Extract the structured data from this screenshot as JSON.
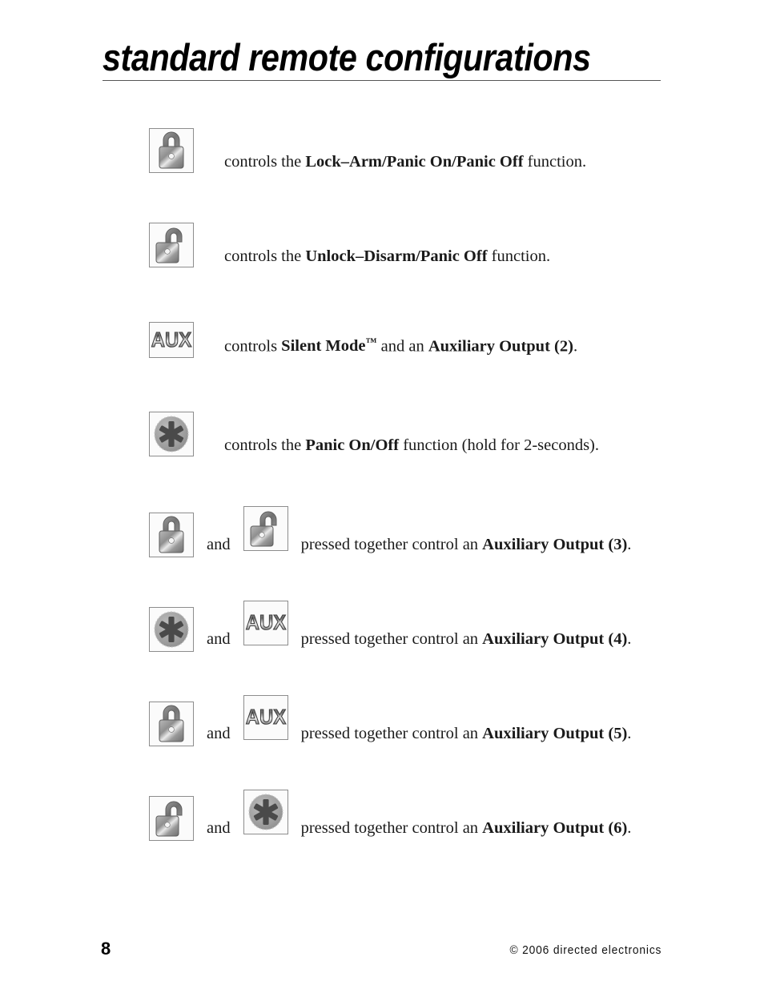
{
  "page": {
    "title": "standard remote configurations",
    "background_color": "#ffffff",
    "text_color": "#000000"
  },
  "icons": {
    "lock": {
      "name": "lock-icon",
      "label": "Lock"
    },
    "unlock": {
      "name": "unlock-icon",
      "label": "Unlock"
    },
    "aux": {
      "name": "aux-icon",
      "label": "AUX"
    },
    "panic": {
      "name": "panic-icon",
      "label": "Panic"
    }
  },
  "rows": [
    {
      "icons": [
        "lock"
      ],
      "pre_text": "controls the ",
      "bold_text": "Lock–Arm/Panic On/Panic Off",
      "post_text": " function."
    },
    {
      "icons": [
        "unlock"
      ],
      "pre_text": "controls the ",
      "bold_text": "Unlock–Disarm/Panic Off",
      "post_text": " function."
    },
    {
      "icons": [
        "aux"
      ],
      "pre_text": "controls ",
      "bold_text": "Silent Mode",
      "bold_tm": "™",
      "mid_text": " and an ",
      "bold_text2": "Auxiliary Output (2)",
      "post_text": "."
    },
    {
      "icons": [
        "panic"
      ],
      "pre_text": "controls the ",
      "bold_text": "Panic On/Off",
      "post_text": " function (hold for 2-seconds)."
    },
    {
      "icons": [
        "lock",
        "unlock"
      ],
      "conjunction": "and",
      "pre_text": "pressed together control an ",
      "bold_text": "Auxiliary Output (3)",
      "post_text": "."
    },
    {
      "icons": [
        "panic",
        "aux"
      ],
      "conjunction": "and",
      "pre_text": "pressed together control an ",
      "bold_text": "Auxiliary Output (4)",
      "post_text": "."
    },
    {
      "icons": [
        "lock",
        "aux"
      ],
      "conjunction": "and",
      "pre_text": "pressed together control an ",
      "bold_text": "Auxiliary Output (5)",
      "post_text": "."
    },
    {
      "icons": [
        "unlock",
        "panic"
      ],
      "conjunction": "and",
      "pre_text": "pressed together control an ",
      "bold_text": "Auxiliary Output (6)",
      "post_text": "."
    }
  ],
  "footer": {
    "page_number": "8",
    "copyright": "© 2006 directed electronics"
  }
}
